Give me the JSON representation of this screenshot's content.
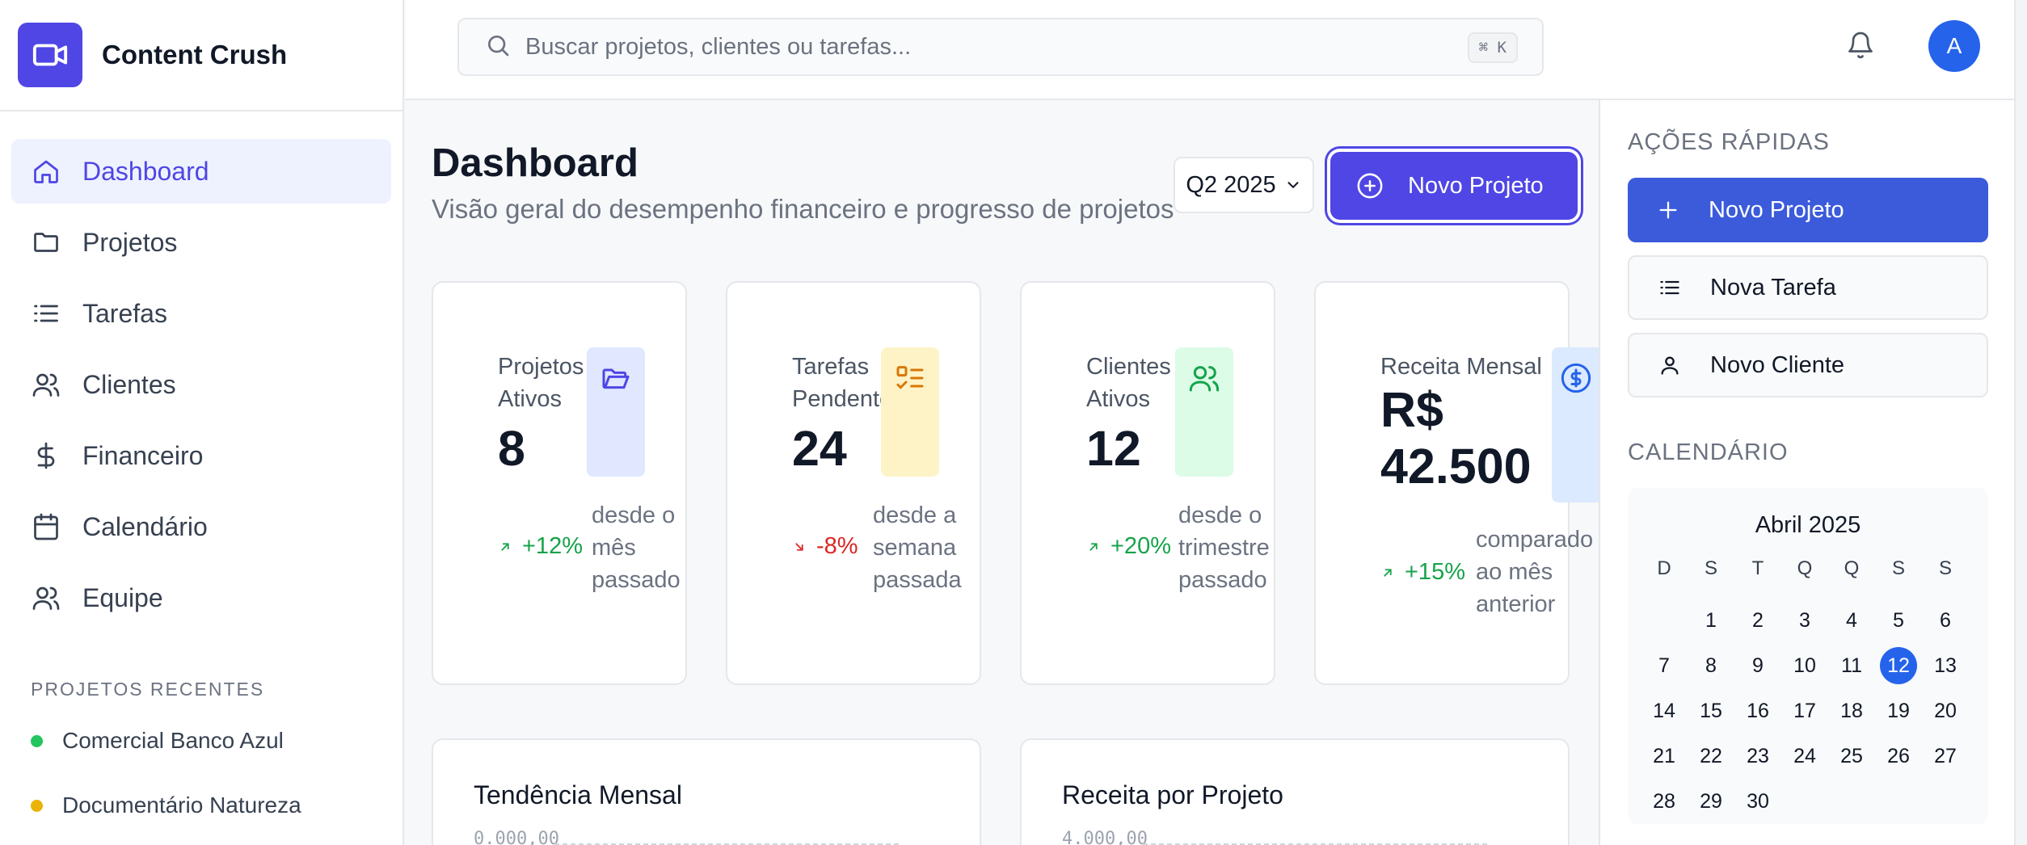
{
  "app": {
    "name": "Content Crush"
  },
  "sidebar": {
    "items": [
      {
        "label": "Dashboard",
        "icon": "home-icon",
        "active": true
      },
      {
        "label": "Projetos",
        "icon": "folder-icon"
      },
      {
        "label": "Tarefas",
        "icon": "list-icon"
      },
      {
        "label": "Clientes",
        "icon": "users-icon"
      },
      {
        "label": "Financeiro",
        "icon": "dollar-icon"
      },
      {
        "label": "Calendário",
        "icon": "calendar-icon"
      },
      {
        "label": "Equipe",
        "icon": "team-icon"
      }
    ],
    "recent_label": "PROJETOS RECENTES",
    "recent": [
      {
        "label": "Comercial Banco Azul",
        "color": "#22c55e"
      },
      {
        "label": "Documentário Natureza",
        "color": "#eab308"
      }
    ]
  },
  "topbar": {
    "search_placeholder": "Buscar projetos, clientes ou tarefas...",
    "shortcut": "⌘ K",
    "avatar_initial": "A"
  },
  "header": {
    "title": "Dashboard",
    "subtitle": "Visão geral do desempenho financeiro e progresso de projetos",
    "quarter": "Q2 2025",
    "new_project": "Novo Projeto"
  },
  "stats": [
    {
      "label": "Projetos Ativos",
      "value": "8",
      "change": "+12%",
      "trend": "up",
      "note": "desde o mês passado",
      "icon": "folder-open-icon",
      "icon_bg": "#e0e7ff",
      "icon_color": "#4f46e5"
    },
    {
      "label": "Tarefas Pendentes",
      "value": "24",
      "change": "-8%",
      "trend": "down",
      "note": "desde a semana passada",
      "icon": "checklist-icon",
      "icon_bg": "#fef3c7",
      "icon_color": "#d97706"
    },
    {
      "label": "Clientes Ativos",
      "value": "12",
      "change": "+20%",
      "trend": "up",
      "note": "desde o trimestre passado",
      "icon": "users-icon",
      "icon_bg": "#dcfce7",
      "icon_color": "#16a34a"
    },
    {
      "label": "Receita Mensal",
      "value": "R$ 42.500",
      "change": "+15%",
      "trend": "up",
      "note": "comparado ao mês anterior",
      "icon": "dollar-circle-icon",
      "icon_bg": "#dbeafe",
      "icon_color": "#2563eb"
    }
  ],
  "charts": [
    {
      "title": "Tendência Mensal",
      "tick": "0.000,00"
    },
    {
      "title": "Receita por Projeto",
      "tick": "4.000,00"
    }
  ],
  "quick_actions": {
    "label": "AÇÕES RÁPIDAS",
    "items": [
      {
        "label": "Novo Projeto",
        "icon": "plus-icon"
      },
      {
        "label": "Nova Tarefa",
        "icon": "list-icon"
      },
      {
        "label": "Novo Cliente",
        "icon": "user-icon"
      }
    ]
  },
  "calendar": {
    "label": "CALENDÁRIO",
    "month": "Abril 2025",
    "weekdays": [
      "D",
      "S",
      "T",
      "Q",
      "Q",
      "S",
      "S"
    ],
    "start_offset": 1,
    "days": 30,
    "today": 12
  },
  "colors": {
    "accent": "#4f46e5",
    "primary_button": "#3b5bdb",
    "up": "#16a34a",
    "down": "#dc2626"
  }
}
